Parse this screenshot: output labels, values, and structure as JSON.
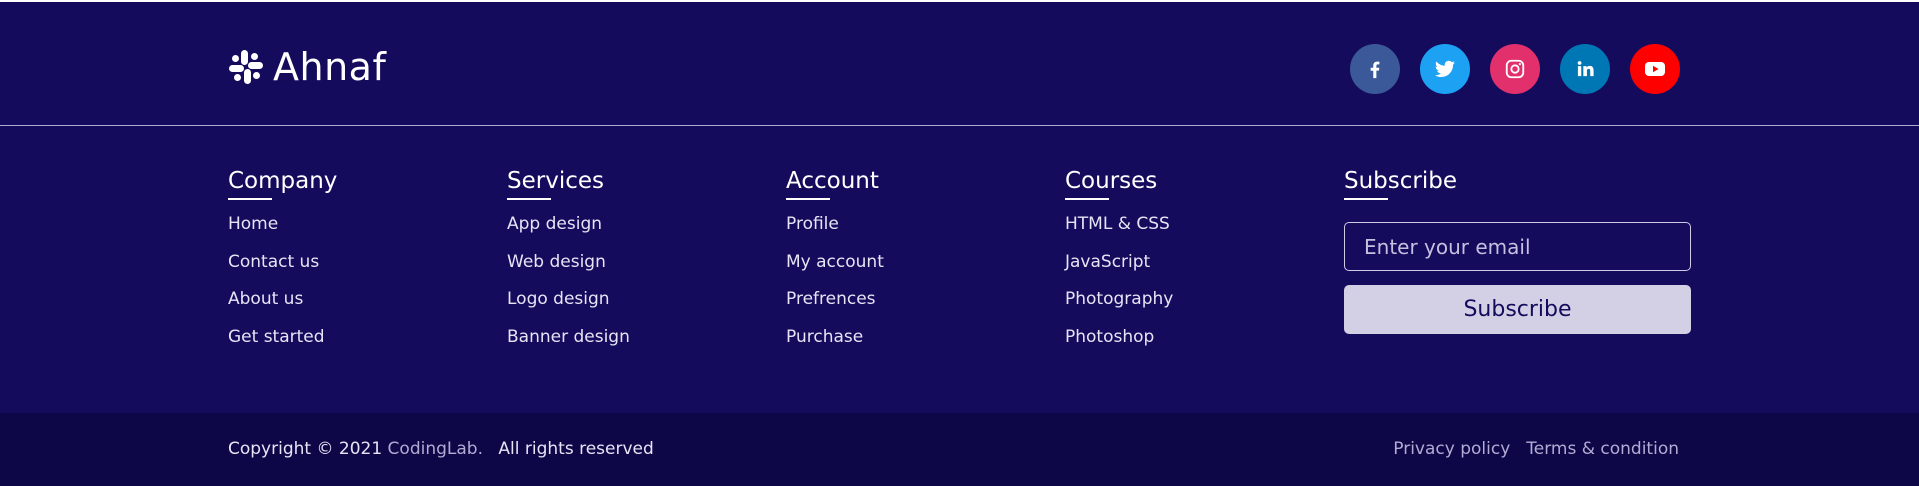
{
  "brand": {
    "name": "Ahnaf",
    "icon": "slack-logo-icon"
  },
  "social": [
    {
      "name": "facebook",
      "icon": "facebook-icon",
      "color": "#3b5998"
    },
    {
      "name": "twitter",
      "icon": "twitter-icon",
      "color": "#1da1f2"
    },
    {
      "name": "instagram",
      "icon": "instagram-icon",
      "color": "#e1306c"
    },
    {
      "name": "linkedin",
      "icon": "linkedin-icon",
      "color": "#0077b5"
    },
    {
      "name": "youtube",
      "icon": "youtube-icon",
      "color": "#ff0000"
    }
  ],
  "columns": [
    {
      "title": "Company",
      "links": [
        "Home",
        "Contact us",
        "About us",
        "Get started"
      ]
    },
    {
      "title": "Services",
      "links": [
        "App design",
        "Web design",
        "Logo design",
        "Banner design"
      ]
    },
    {
      "title": "Account",
      "links": [
        "Profile",
        "My account",
        "Prefrences",
        "Purchase"
      ]
    },
    {
      "title": "Courses",
      "links": [
        "HTML & CSS",
        "JavaScript",
        "Photography",
        "Photoshop"
      ]
    }
  ],
  "subscribe": {
    "title": "Subscribe",
    "placeholder": "Enter your email",
    "button_label": "Subscribe"
  },
  "bottom": {
    "copyright_prefix": "Copyright © 2021",
    "copyright_brand": "CodingLab.",
    "rights": "All rights reserved",
    "links": [
      "Privacy policy",
      "Terms & condition"
    ]
  },
  "colors": {
    "background": "#140b5c",
    "bottom_bar": "#0e0747",
    "subscribe_button": "#d3cfe5"
  }
}
